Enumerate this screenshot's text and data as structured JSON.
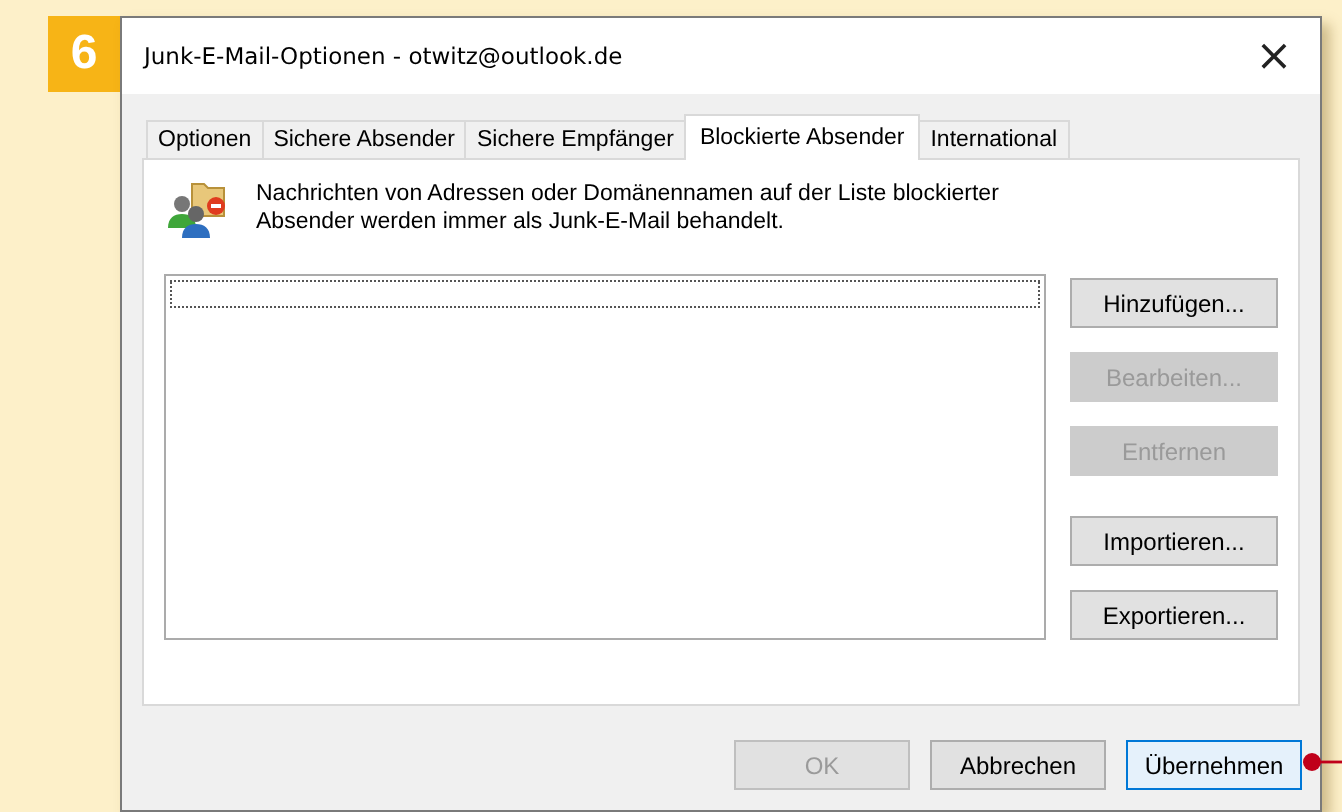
{
  "step_badge": "6",
  "window": {
    "title": "Junk-E-Mail-Optionen - otwitz@outlook.de",
    "close": "×"
  },
  "tabs": [
    {
      "label": "Optionen",
      "selected": false
    },
    {
      "label": "Sichere Absender",
      "selected": false
    },
    {
      "label": "Sichere Empfänger",
      "selected": false
    },
    {
      "label": "Blockierte Absender",
      "selected": true
    },
    {
      "label": "International",
      "selected": false
    }
  ],
  "description": "Nachrichten von Adressen oder Domänennamen auf der Liste blockierter Absender werden immer als Junk-E-Mail behandelt.",
  "side_button_groups": [
    [
      {
        "label": "Hinzufügen...",
        "disabled": false
      },
      {
        "label": "Bearbeiten...",
        "disabled": true
      },
      {
        "label": "Entfernen",
        "disabled": true
      }
    ],
    [
      {
        "label": "Importieren...",
        "disabled": false
      },
      {
        "label": "Exportieren...",
        "disabled": false
      }
    ]
  ],
  "footer_buttons": [
    {
      "label": "OK",
      "disabled": true,
      "focused": false
    },
    {
      "label": "Abbrechen",
      "disabled": false,
      "focused": false
    },
    {
      "label": "Übernehmen",
      "disabled": false,
      "focused": true
    }
  ]
}
